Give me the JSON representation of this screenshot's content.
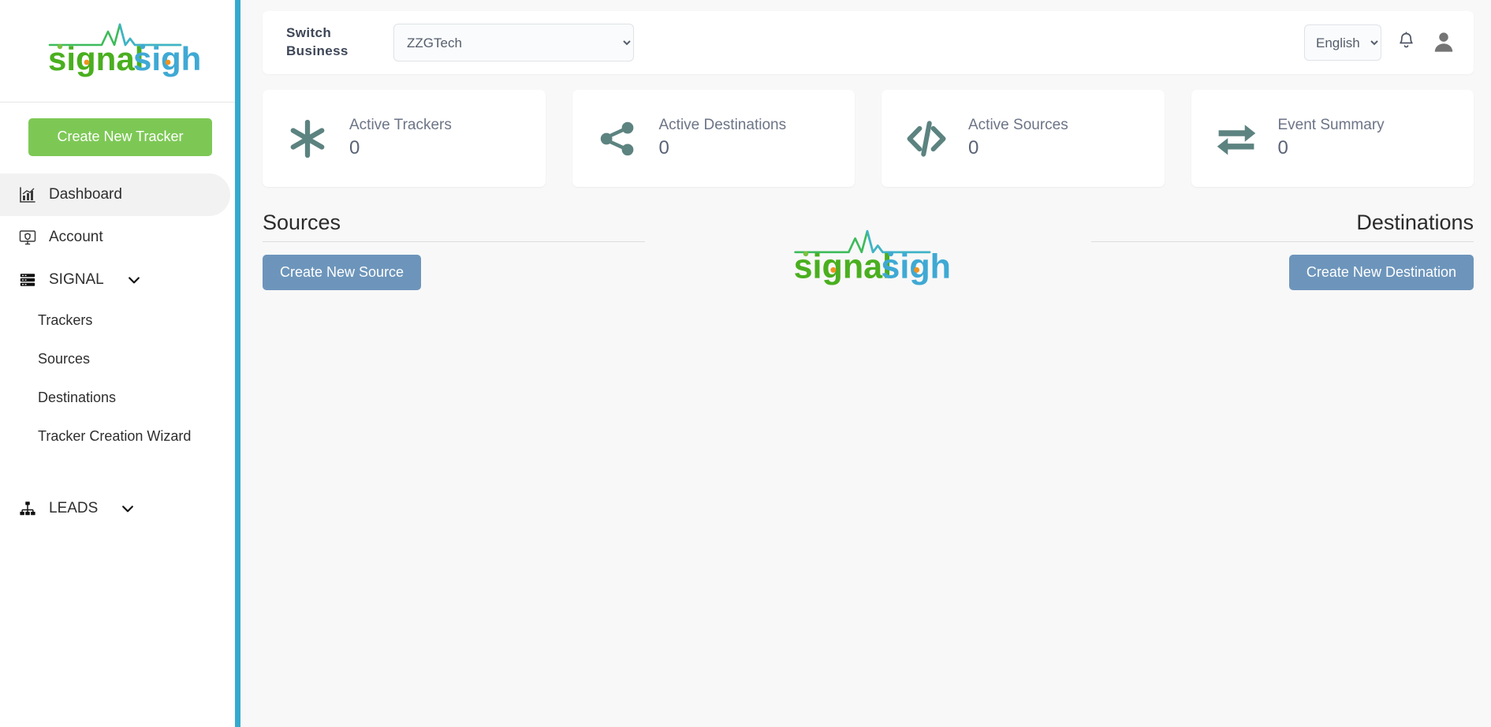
{
  "brand": {
    "name": "signalsight",
    "part_green": "signal",
    "part_blue": "sight",
    "green": "#4aaf1f",
    "blue": "#3fa9d4",
    "orange": "#f0921e",
    "pulse_green": "#3dbb5a",
    "pulse_blue": "#3fb3c9"
  },
  "sidebar": {
    "create_tracker_label": "Create New Tracker",
    "items": [
      {
        "label": "Dashboard",
        "icon": "chart-bars-icon",
        "active": true
      },
      {
        "label": "Account",
        "icon": "monitor-shield-icon",
        "active": false
      }
    ],
    "groups": [
      {
        "label": "SIGNAL",
        "icon": "server-stack-icon",
        "expanded": true,
        "children": [
          {
            "label": "Trackers"
          },
          {
            "label": "Sources"
          },
          {
            "label": "Destinations"
          },
          {
            "label": "Tracker Creation Wizard"
          }
        ]
      },
      {
        "label": "LEADS",
        "icon": "sitemap-icon",
        "expanded": false,
        "children": []
      }
    ]
  },
  "topbar": {
    "switch_business_label": "Switch\nBusiness",
    "switch_business_line1": "Switch",
    "switch_business_line2": "Business",
    "business_selected": "ZZGTech",
    "business_options": [
      "ZZGTech"
    ],
    "language_selected": "English",
    "language_options": [
      "English"
    ],
    "notification_icon": "bell-icon",
    "avatar_icon": "user-avatar-icon"
  },
  "cards": [
    {
      "title": "Active Trackers",
      "value": "0",
      "icon": "asterisk-icon"
    },
    {
      "title": "Active Destinations",
      "value": "0",
      "icon": "share-nodes-icon"
    },
    {
      "title": "Active Sources",
      "value": "0",
      "icon": "code-icon"
    },
    {
      "title": "Event Summary",
      "value": "0",
      "icon": "exchange-arrows-icon"
    }
  ],
  "sections": {
    "sources": {
      "title": "Sources",
      "button_label": "Create New Source"
    },
    "destinations": {
      "title": "Destinations",
      "button_label": "Create New Destination"
    }
  },
  "colors": {
    "accent_rail": "#35aacd",
    "create_green": "#7dc855",
    "action_blue": "#6d95bb",
    "card_icon": "#5c8380",
    "main_bg": "#f8f8f8"
  }
}
